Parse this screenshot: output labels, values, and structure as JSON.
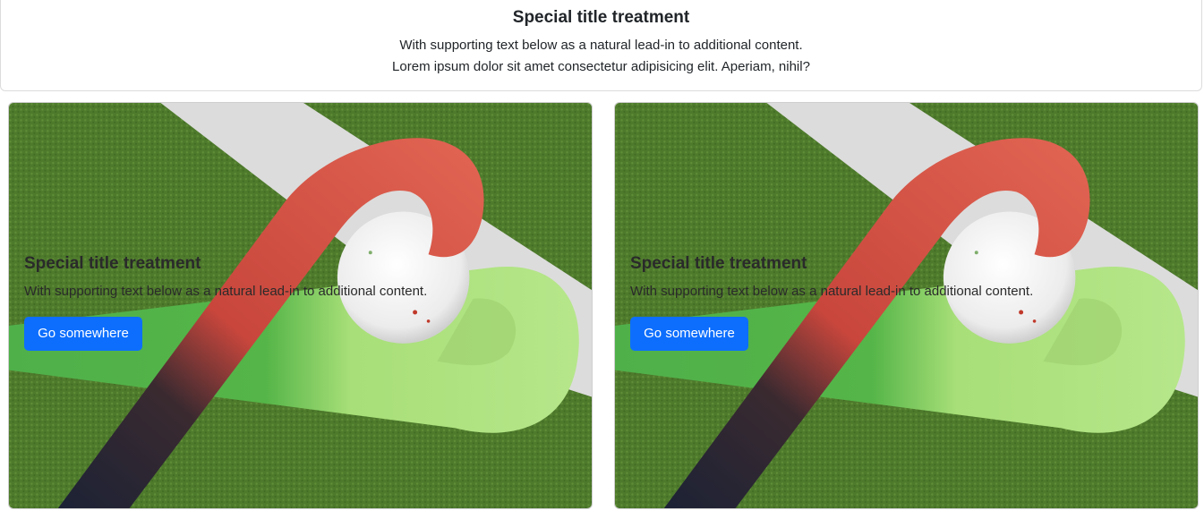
{
  "header": {
    "title": "Special title treatment",
    "text_line1": "With supporting text below as a natural lead-in to additional content.",
    "text_line2": "Lorem ipsum dolor sit amet consectetur adipisicing elit. Aperiam, nihil?"
  },
  "cards": [
    {
      "title": "Special title treatment",
      "text": "With supporting text below as a natural lead-in to additional content.",
      "button_label": "Go somewhere",
      "image": "hockey-stick-and-ball-image"
    },
    {
      "title": "Special title treatment",
      "text": "With supporting text below as a natural lead-in to additional content.",
      "button_label": "Go somewhere",
      "image": "hockey-stick-and-ball-image"
    }
  ],
  "colors": {
    "button_primary": "#0d6efd",
    "turf_green": "#4f7a2e",
    "stick_red": "#d9534a",
    "stick_green": "#9fd66a"
  }
}
